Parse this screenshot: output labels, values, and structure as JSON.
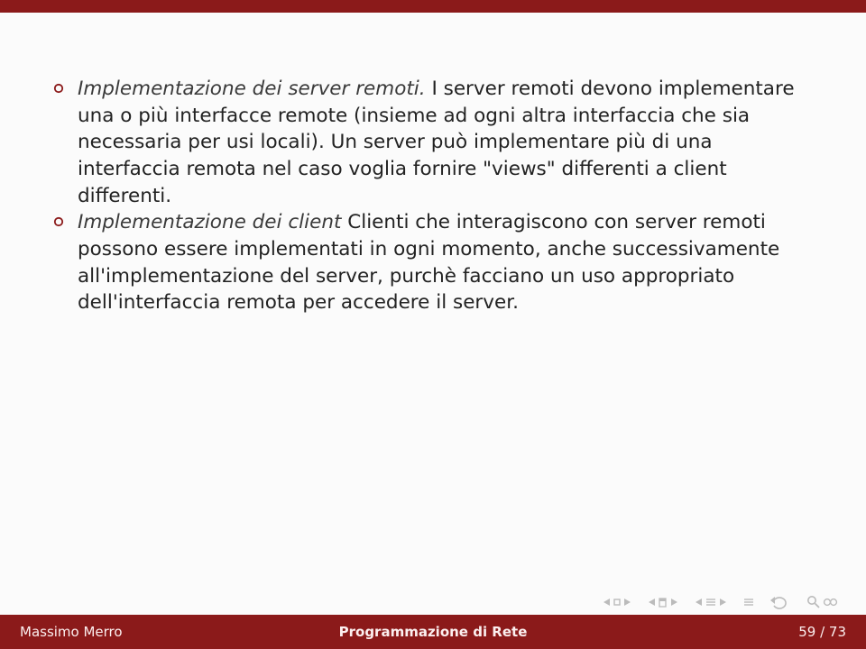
{
  "bullets": [
    {
      "title": "Implementazione dei server remoti.",
      "body": "I server remoti devono implementare una o più interfacce remote (insieme ad ogni altra interfaccia che sia necessaria per usi locali). Un server può implementare più di una interfaccia remota nel caso voglia fornire \"views\" differenti a client differenti."
    },
    {
      "title": "Implementazione dei client",
      "body": "Clienti che interagiscono con server remoti possono essere implementati in ogni momento, anche successivamente all'implementazione del server, purchè facciano un uso appropriato dell'interfaccia remota per accedere il server."
    }
  ],
  "footer": {
    "author": "Massimo Merro",
    "title": "Programmazione di Rete",
    "page": "59 / 73"
  }
}
